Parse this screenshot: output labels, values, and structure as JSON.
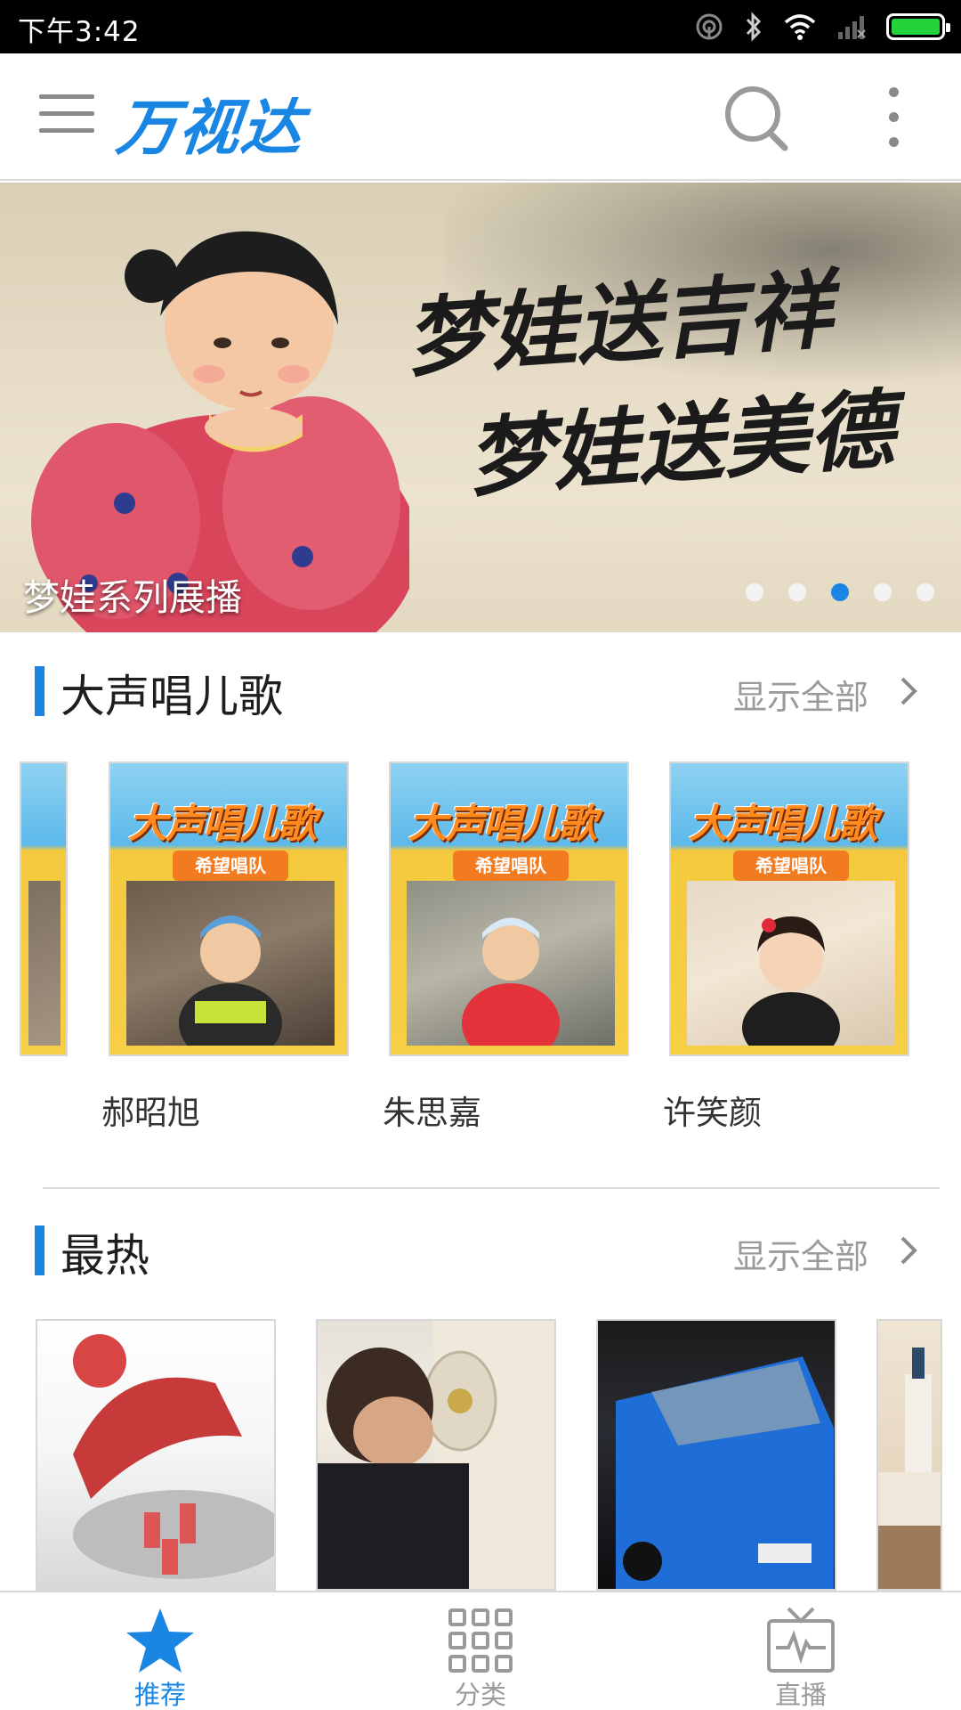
{
  "status_bar": {
    "time": "下午3:42",
    "icons": [
      "hotspot-icon",
      "bluetooth-icon",
      "wifi-icon",
      "signal-icon",
      "battery-icon"
    ],
    "battery_color": "#22d33a"
  },
  "app_bar": {
    "logo": "万视达",
    "brand_color": "#1a86e3",
    "icons": [
      "menu-icon",
      "search-icon",
      "more-icon"
    ]
  },
  "banner": {
    "caption": "梦娃系列展播",
    "calligraphy_line1": "梦娃送吉祥",
    "calligraphy_line2": "梦娃送美德",
    "slide_count": 5,
    "active_slide_index": 2
  },
  "section_songs": {
    "title": "大声唱儿歌",
    "show_all": "显示全部",
    "cards": [
      {
        "name": "郝昭旭",
        "card_title": "大声唱儿歌",
        "ribbon": "希望唱队"
      },
      {
        "name": "朱思嘉",
        "card_title": "大声唱儿歌",
        "ribbon": "希望唱队"
      },
      {
        "name": "许笑颜",
        "card_title": "大声唱儿歌",
        "ribbon": "希望唱队"
      }
    ]
  },
  "section_hot": {
    "title": "最热",
    "show_all": "显示全部"
  },
  "bottom_nav": {
    "items": [
      {
        "label": "推荐",
        "icon": "star-icon",
        "active": true
      },
      {
        "label": "分类",
        "icon": "grid-icon",
        "active": false
      },
      {
        "label": "直播",
        "icon": "tv-icon",
        "active": false
      }
    ],
    "active_color": "#1a86e3",
    "inactive_color": "#9a9a9a"
  }
}
